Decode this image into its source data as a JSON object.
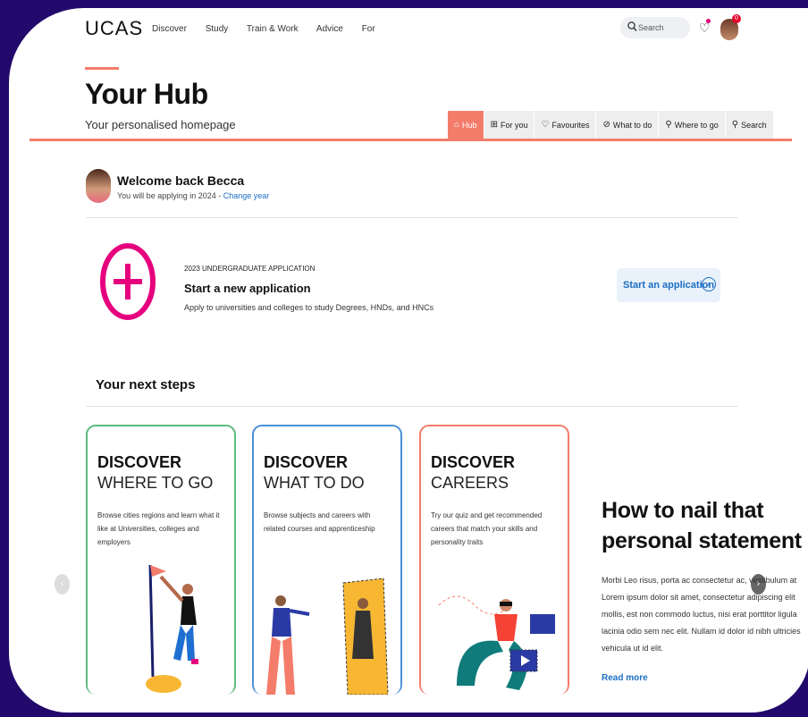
{
  "nav": {
    "logo": "UCAS",
    "links": [
      "Discover",
      "Study",
      "Train & Work",
      "Advice",
      "For"
    ],
    "search_placeholder": "Search",
    "notification_count": "0"
  },
  "hub": {
    "title": "Your Hub",
    "subtitle": "Your personalised homepage",
    "tabs": [
      {
        "label": "Hub",
        "icon": "home-icon",
        "glyph": "⌂",
        "active": true
      },
      {
        "label": "For you",
        "icon": "grid-icon",
        "glyph": "⊞",
        "active": false
      },
      {
        "label": "Favourites",
        "icon": "heart-icon",
        "glyph": "♡",
        "active": false
      },
      {
        "label": "What to do",
        "icon": "compass-icon",
        "glyph": "⊘",
        "active": false
      },
      {
        "label": "Where to go",
        "icon": "pin-icon",
        "glyph": "⚲",
        "active": false
      },
      {
        "label": "Search",
        "icon": "search-icon",
        "glyph": "⚲",
        "active": false
      }
    ]
  },
  "welcome": {
    "title": "Welcome back Becca",
    "subtitle": "You will be applying in 2024 - ",
    "change_link": "Change year"
  },
  "application": {
    "tag": "2023 UNDERGRADUATE APPLICATION",
    "title": "Start a new application",
    "description": "Apply to universities and colleges to study Degrees, HNDs, and HNCs",
    "button": "Start an application"
  },
  "next_steps": {
    "title": "Your next steps",
    "cards": [
      {
        "kicker": "DISCOVER",
        "heading": "WHERE TO GO",
        "desc": "Browse cities regions and learn what it like at Universities, colleges and employers",
        "border": "#5dbb80"
      },
      {
        "kicker": "DISCOVER",
        "heading": "WHAT TO DO",
        "desc": "Browse subjects and careers with related courses and apprenticeship",
        "border": "#4a90d9"
      },
      {
        "kicker": "DISCOVER",
        "heading": "CAREERS",
        "desc": "Try our quiz and get recommended careers that match your skills and personality traits",
        "border": "#f47c6b"
      }
    ]
  },
  "article": {
    "title": "How to nail that personal statement",
    "body": "Morbi Leo risus, porta ac consectetur ac, vestibulum at Lorem ipsum dolor sit amet, consectetur adipiscing elit mollis, est non commodo luctus, nisi erat porttitor ligula lacinia odio sem nec elit. Nullam id dolor id nibh ultricies vehicula ut id elit.",
    "read_more": "Read more"
  },
  "colors": {
    "accent": "#f47c6b",
    "link": "#1b6ec2",
    "magenta": "#e6007e",
    "frame": "#22096b"
  }
}
